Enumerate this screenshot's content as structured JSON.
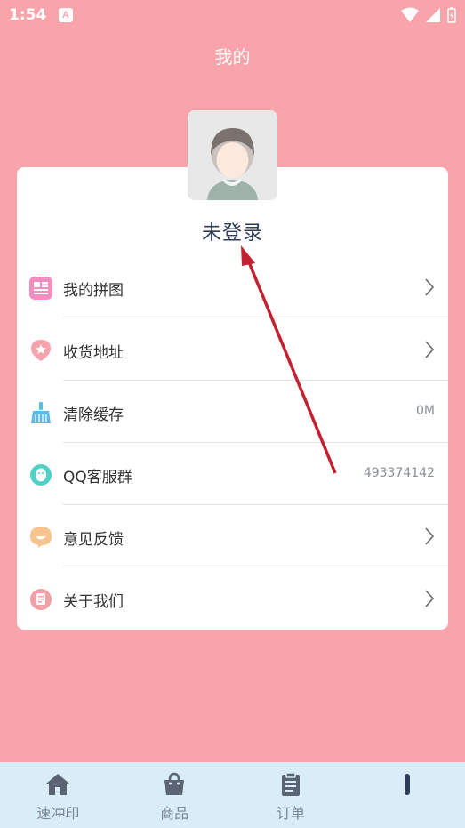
{
  "status": {
    "time": "1:54",
    "notif": "A"
  },
  "header": {
    "title": "我的"
  },
  "profile": {
    "login_text": "未登录"
  },
  "menu": [
    {
      "label": "我的拼图",
      "value": ""
    },
    {
      "label": "收货地址",
      "value": ""
    },
    {
      "label": "清除缓存",
      "value": "0M"
    },
    {
      "label": "QQ客服群",
      "value": "493374142"
    },
    {
      "label": "意见反馈",
      "value": ""
    },
    {
      "label": "关于我们",
      "value": ""
    }
  ],
  "tabs": [
    {
      "label": "速冲印",
      "icon": "home-icon"
    },
    {
      "label": "商品",
      "icon": "bag-icon"
    },
    {
      "label": "订单",
      "icon": "clipboard-icon"
    },
    {
      "label": "",
      "icon": "profile-icon"
    }
  ],
  "colors": {
    "background": "#f9a3aa",
    "bottom_nav": "#d8edf8",
    "arrow": "#c42030"
  }
}
